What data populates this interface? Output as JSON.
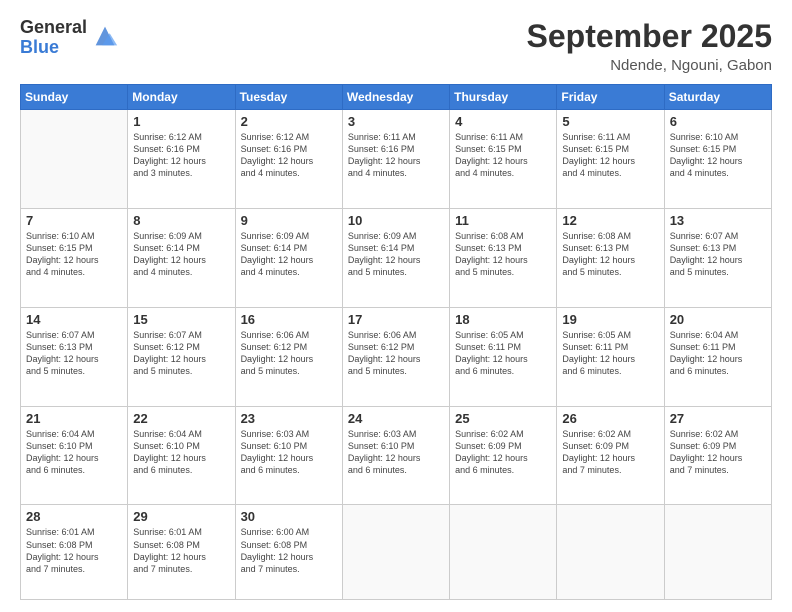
{
  "logo": {
    "general": "General",
    "blue": "Blue"
  },
  "header": {
    "month": "September 2025",
    "location": "Ndende, Ngouni, Gabon"
  },
  "weekdays": [
    "Sunday",
    "Monday",
    "Tuesday",
    "Wednesday",
    "Thursday",
    "Friday",
    "Saturday"
  ],
  "weeks": [
    [
      {
        "day": "",
        "sunrise": "",
        "sunset": "",
        "daylight": ""
      },
      {
        "day": "1",
        "sunrise": "Sunrise: 6:12 AM",
        "sunset": "Sunset: 6:16 PM",
        "daylight": "Daylight: 12 hours and 3 minutes."
      },
      {
        "day": "2",
        "sunrise": "Sunrise: 6:12 AM",
        "sunset": "Sunset: 6:16 PM",
        "daylight": "Daylight: 12 hours and 4 minutes."
      },
      {
        "day": "3",
        "sunrise": "Sunrise: 6:11 AM",
        "sunset": "Sunset: 6:16 PM",
        "daylight": "Daylight: 12 hours and 4 minutes."
      },
      {
        "day": "4",
        "sunrise": "Sunrise: 6:11 AM",
        "sunset": "Sunset: 6:15 PM",
        "daylight": "Daylight: 12 hours and 4 minutes."
      },
      {
        "day": "5",
        "sunrise": "Sunrise: 6:11 AM",
        "sunset": "Sunset: 6:15 PM",
        "daylight": "Daylight: 12 hours and 4 minutes."
      },
      {
        "day": "6",
        "sunrise": "Sunrise: 6:10 AM",
        "sunset": "Sunset: 6:15 PM",
        "daylight": "Daylight: 12 hours and 4 minutes."
      }
    ],
    [
      {
        "day": "7",
        "sunrise": "Sunrise: 6:10 AM",
        "sunset": "Sunset: 6:15 PM",
        "daylight": "Daylight: 12 hours and 4 minutes."
      },
      {
        "day": "8",
        "sunrise": "Sunrise: 6:09 AM",
        "sunset": "Sunset: 6:14 PM",
        "daylight": "Daylight: 12 hours and 4 minutes."
      },
      {
        "day": "9",
        "sunrise": "Sunrise: 6:09 AM",
        "sunset": "Sunset: 6:14 PM",
        "daylight": "Daylight: 12 hours and 4 minutes."
      },
      {
        "day": "10",
        "sunrise": "Sunrise: 6:09 AM",
        "sunset": "Sunset: 6:14 PM",
        "daylight": "Daylight: 12 hours and 5 minutes."
      },
      {
        "day": "11",
        "sunrise": "Sunrise: 6:08 AM",
        "sunset": "Sunset: 6:13 PM",
        "daylight": "Daylight: 12 hours and 5 minutes."
      },
      {
        "day": "12",
        "sunrise": "Sunrise: 6:08 AM",
        "sunset": "Sunset: 6:13 PM",
        "daylight": "Daylight: 12 hours and 5 minutes."
      },
      {
        "day": "13",
        "sunrise": "Sunrise: 6:07 AM",
        "sunset": "Sunset: 6:13 PM",
        "daylight": "Daylight: 12 hours and 5 minutes."
      }
    ],
    [
      {
        "day": "14",
        "sunrise": "Sunrise: 6:07 AM",
        "sunset": "Sunset: 6:13 PM",
        "daylight": "Daylight: 12 hours and 5 minutes."
      },
      {
        "day": "15",
        "sunrise": "Sunrise: 6:07 AM",
        "sunset": "Sunset: 6:12 PM",
        "daylight": "Daylight: 12 hours and 5 minutes."
      },
      {
        "day": "16",
        "sunrise": "Sunrise: 6:06 AM",
        "sunset": "Sunset: 6:12 PM",
        "daylight": "Daylight: 12 hours and 5 minutes."
      },
      {
        "day": "17",
        "sunrise": "Sunrise: 6:06 AM",
        "sunset": "Sunset: 6:12 PM",
        "daylight": "Daylight: 12 hours and 5 minutes."
      },
      {
        "day": "18",
        "sunrise": "Sunrise: 6:05 AM",
        "sunset": "Sunset: 6:11 PM",
        "daylight": "Daylight: 12 hours and 6 minutes."
      },
      {
        "day": "19",
        "sunrise": "Sunrise: 6:05 AM",
        "sunset": "Sunset: 6:11 PM",
        "daylight": "Daylight: 12 hours and 6 minutes."
      },
      {
        "day": "20",
        "sunrise": "Sunrise: 6:04 AM",
        "sunset": "Sunset: 6:11 PM",
        "daylight": "Daylight: 12 hours and 6 minutes."
      }
    ],
    [
      {
        "day": "21",
        "sunrise": "Sunrise: 6:04 AM",
        "sunset": "Sunset: 6:10 PM",
        "daylight": "Daylight: 12 hours and 6 minutes."
      },
      {
        "day": "22",
        "sunrise": "Sunrise: 6:04 AM",
        "sunset": "Sunset: 6:10 PM",
        "daylight": "Daylight: 12 hours and 6 minutes."
      },
      {
        "day": "23",
        "sunrise": "Sunrise: 6:03 AM",
        "sunset": "Sunset: 6:10 PM",
        "daylight": "Daylight: 12 hours and 6 minutes."
      },
      {
        "day": "24",
        "sunrise": "Sunrise: 6:03 AM",
        "sunset": "Sunset: 6:10 PM",
        "daylight": "Daylight: 12 hours and 6 minutes."
      },
      {
        "day": "25",
        "sunrise": "Sunrise: 6:02 AM",
        "sunset": "Sunset: 6:09 PM",
        "daylight": "Daylight: 12 hours and 6 minutes."
      },
      {
        "day": "26",
        "sunrise": "Sunrise: 6:02 AM",
        "sunset": "Sunset: 6:09 PM",
        "daylight": "Daylight: 12 hours and 7 minutes."
      },
      {
        "day": "27",
        "sunrise": "Sunrise: 6:02 AM",
        "sunset": "Sunset: 6:09 PM",
        "daylight": "Daylight: 12 hours and 7 minutes."
      }
    ],
    [
      {
        "day": "28",
        "sunrise": "Sunrise: 6:01 AM",
        "sunset": "Sunset: 6:08 PM",
        "daylight": "Daylight: 12 hours and 7 minutes."
      },
      {
        "day": "29",
        "sunrise": "Sunrise: 6:01 AM",
        "sunset": "Sunset: 6:08 PM",
        "daylight": "Daylight: 12 hours and 7 minutes."
      },
      {
        "day": "30",
        "sunrise": "Sunrise: 6:00 AM",
        "sunset": "Sunset: 6:08 PM",
        "daylight": "Daylight: 12 hours and 7 minutes."
      },
      {
        "day": "",
        "sunrise": "",
        "sunset": "",
        "daylight": ""
      },
      {
        "day": "",
        "sunrise": "",
        "sunset": "",
        "daylight": ""
      },
      {
        "day": "",
        "sunrise": "",
        "sunset": "",
        "daylight": ""
      },
      {
        "day": "",
        "sunrise": "",
        "sunset": "",
        "daylight": ""
      }
    ]
  ]
}
